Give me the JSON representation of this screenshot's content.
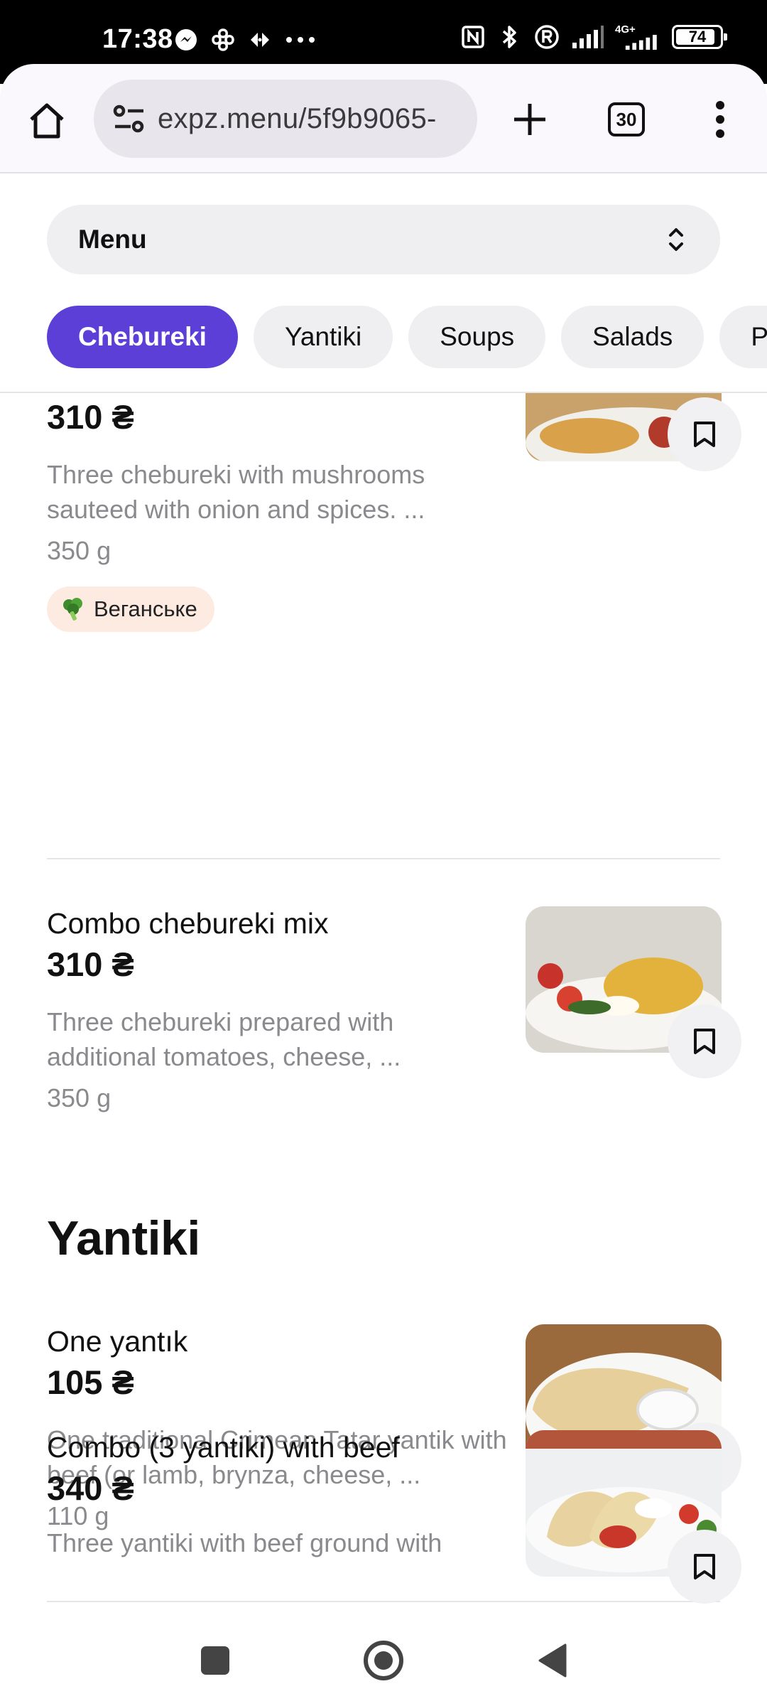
{
  "status_bar": {
    "time": "17:38",
    "left_icons": [
      "messenger-icon",
      "connectivity-icon",
      "cast-icon",
      "more-notifications-icon"
    ],
    "right_icons": [
      "nfc-icon",
      "bluetooth-icon",
      "roaming-icon",
      "signal-icon",
      "signal-4g-icon"
    ],
    "network_label": "4G+",
    "battery": "74"
  },
  "browser": {
    "url": "expz.menu/5f9b9065-",
    "tab_count": "30"
  },
  "menu_selector": {
    "label": "Menu"
  },
  "categories": [
    {
      "label": "Chebureki",
      "active": true
    },
    {
      "label": "Yantiki",
      "active": false
    },
    {
      "label": "Soups",
      "active": false
    },
    {
      "label": "Salads",
      "active": false
    },
    {
      "label": "Pi",
      "active": false
    }
  ],
  "items": [
    {
      "price": "310 ₴",
      "description": "Three chebureki with mushrooms sauteed with onion and spices. ...",
      "weight": "350 g",
      "badge": "Веганське"
    },
    {
      "name": "Combo chebureki mix",
      "price": "310 ₴",
      "description": "Three chebureki prepared with additional tomatoes, cheese, ...",
      "weight": "350 g"
    }
  ],
  "section_yantiki": {
    "title": "Yantiki",
    "items": [
      {
        "name": "One yantık",
        "price": "105 ₴",
        "description": "One traditional Crimean Tatar yantik with beef (or lamb, brynza, cheese, ...",
        "weight": "110 g"
      },
      {
        "name": "Combo (3 yantiki) with beef",
        "price": "340 ₴",
        "description": "Three yantiki with beef ground with"
      }
    ]
  },
  "colors": {
    "accent": "#5b3fd6",
    "badge_bg": "#fdebe2",
    "muted_text": "#8a8a8e"
  }
}
